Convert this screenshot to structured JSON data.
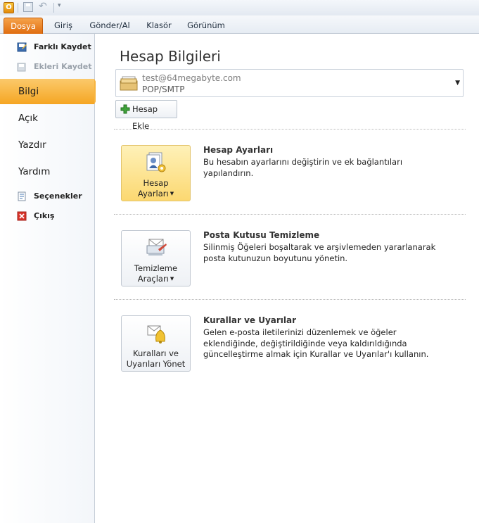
{
  "qat": {
    "app_letter": "O"
  },
  "tabs": [
    "Dosya",
    "Giriş",
    "Gönder/Al",
    "Klasör",
    "Görünüm"
  ],
  "nav": {
    "save_as": "Farklı Kaydet",
    "save_attachments": "Ekleri Kaydet",
    "info": "Bilgi",
    "open": "Açık",
    "print": "Yazdır",
    "help": "Yardım",
    "options": "Seçenekler",
    "exit": "Çıkış"
  },
  "main": {
    "title": "Hesap Bilgileri",
    "account": {
      "email": "test@64megabyte.com",
      "type": "POP/SMTP"
    },
    "add_account": "Hesap Ekle",
    "sections": [
      {
        "button_line1": "Hesap",
        "button_line2": "Ayarları",
        "title": "Hesap Ayarları",
        "description": "Bu hesabın ayarlarını değiştirin ve ek bağlantıları yapılandırın."
      },
      {
        "button_line1": "Temizleme",
        "button_line2": "Araçları",
        "title": "Posta Kutusu Temizleme",
        "description": "Silinmiş Öğeleri boşaltarak ve arşivlemeden yararlanarak posta kutunuzun boyutunu yönetin."
      },
      {
        "button_line1": "Kuralları ve",
        "button_line2": "Uyarıları Yönet",
        "title": "Kurallar ve Uyarılar",
        "description": "Gelen e-posta iletilerinizi düzenlemek ve öğeler eklendiğinde, değiştirildiğinde veya kaldırıldığında güncelleştirme almak için Kurallar ve Uyarılar'ı kullanın."
      }
    ]
  },
  "colors": {
    "file_tab": "#e06d10",
    "active_nav": "#f5a623",
    "highlight_button": "#fcd871"
  }
}
